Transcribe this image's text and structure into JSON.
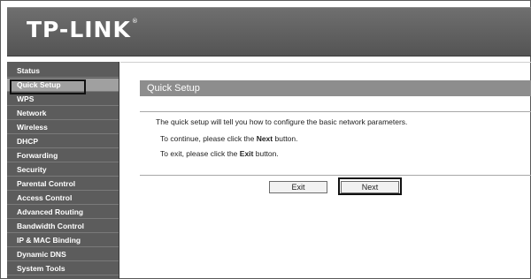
{
  "header": {
    "logo": "TP-LINK",
    "logo_mark": "®"
  },
  "sidebar": {
    "items": [
      {
        "label": "Status"
      },
      {
        "label": "Quick Setup"
      },
      {
        "label": "WPS"
      },
      {
        "label": "Network"
      },
      {
        "label": "Wireless"
      },
      {
        "label": "DHCP"
      },
      {
        "label": "Forwarding"
      },
      {
        "label": "Security"
      },
      {
        "label": "Parental Control"
      },
      {
        "label": "Access Control"
      },
      {
        "label": "Advanced Routing"
      },
      {
        "label": "Bandwidth Control"
      },
      {
        "label": "IP & MAC Binding"
      },
      {
        "label": "Dynamic DNS"
      },
      {
        "label": "System Tools"
      }
    ],
    "active": "Quick Setup"
  },
  "main": {
    "title": "Quick Setup",
    "intro": "The quick setup will tell you how to configure the basic network parameters.",
    "continue_prefix": "To continue, please click the",
    "continue_bold": "Next",
    "continue_suffix": "button.",
    "exit_prefix": "To exit, please click the",
    "exit_bold": "Exit",
    "exit_suffix": "button."
  },
  "buttons": {
    "exit": "Exit",
    "next": "Next"
  }
}
